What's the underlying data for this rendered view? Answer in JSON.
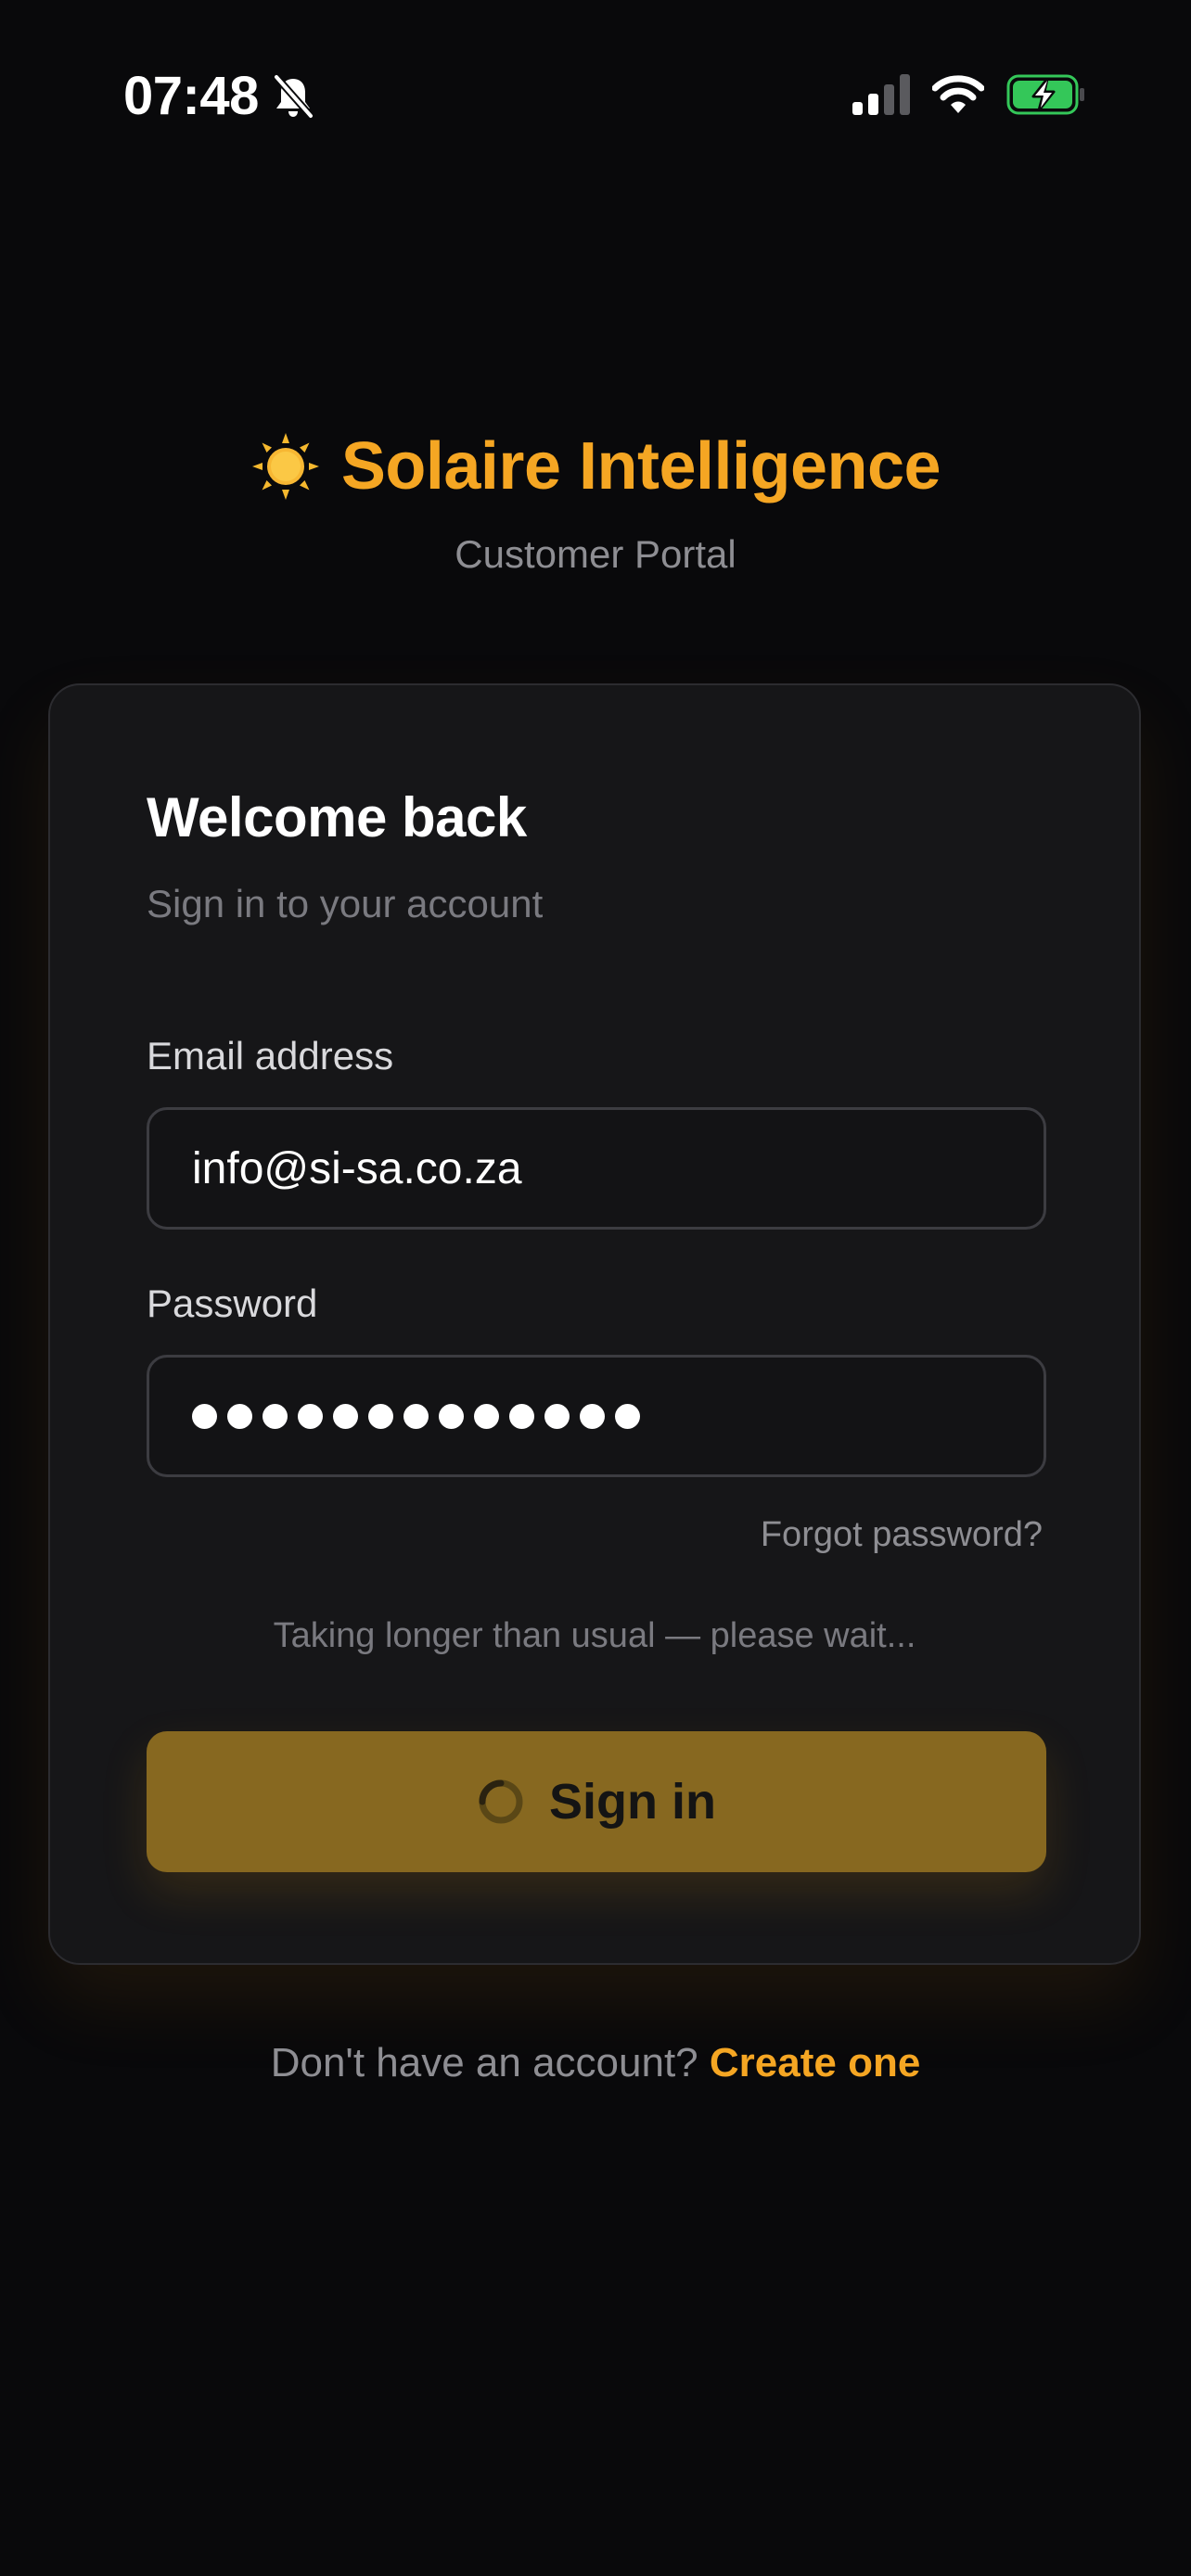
{
  "status_bar": {
    "time": "07:48",
    "icons": [
      "bell-slash-icon",
      "signal-icon",
      "wifi-icon",
      "battery-charging-icon"
    ],
    "battery_color": "#34c759"
  },
  "brand": {
    "icon": "sun-icon",
    "name": "Solaire Intelligence",
    "tagline": "Customer Portal",
    "accent_color": "#f5a623"
  },
  "login_card": {
    "title": "Welcome back",
    "subtitle": "Sign in to your account",
    "email": {
      "label": "Email address",
      "value": "info@si-sa.co.za"
    },
    "password": {
      "label": "Password",
      "masked_length": 13
    },
    "forgot_password": "Forgot password?",
    "wait_message": "Taking longer than usual — please wait...",
    "submit": {
      "label": "Sign in",
      "state": "loading",
      "icon": "spinner-icon",
      "color": "#876820"
    }
  },
  "footer": {
    "prompt": "Don't have an account?",
    "link": "Create one"
  }
}
